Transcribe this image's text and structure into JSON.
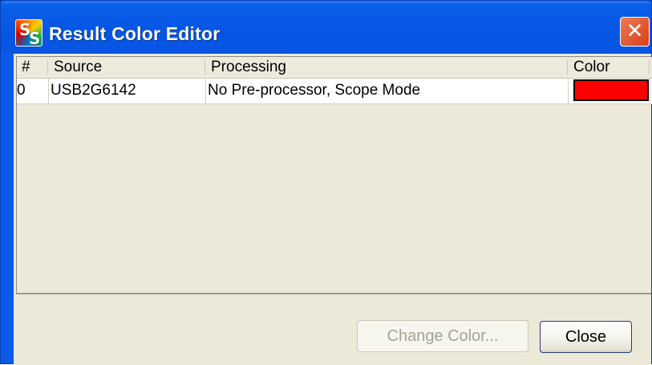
{
  "window": {
    "title": "Result Color Editor",
    "close_glyph": "✕",
    "icon_name": "app-logo-icon",
    "icon_letters": [
      "S",
      "S"
    ]
  },
  "table": {
    "columns": [
      "#",
      "Source",
      "Processing",
      "Color"
    ],
    "rows": [
      {
        "num": "0",
        "source": "USB2G6142",
        "processing": "No Pre-processor, Scope Mode",
        "color": "#ff0000"
      }
    ]
  },
  "buttons": {
    "change_color": "Change Color...",
    "close": "Close"
  },
  "colors": {
    "titlebar": "#0656e5",
    "client_bg": "#ece9d8",
    "swatch_red": "#ff0000"
  }
}
